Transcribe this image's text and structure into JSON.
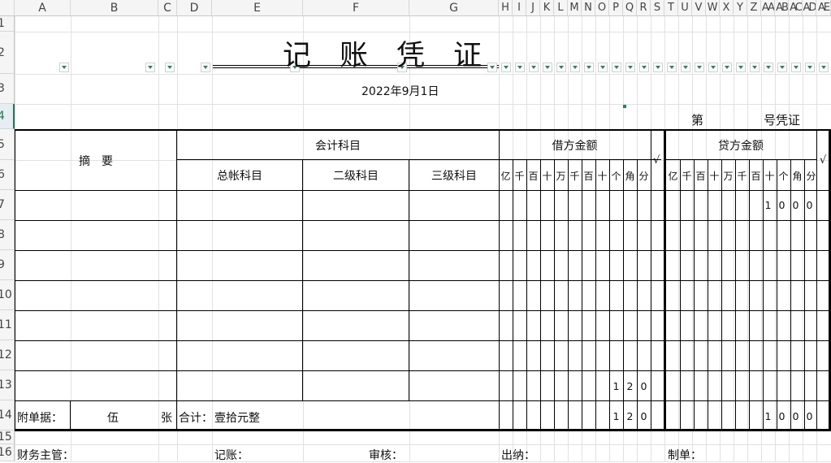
{
  "columns": [
    "A",
    "B",
    "C",
    "D",
    "E",
    "F",
    "G",
    "H",
    "I",
    "J",
    "K",
    "L",
    "M",
    "N",
    "O",
    "P",
    "Q",
    "R",
    "S",
    "T",
    "U",
    "V",
    "W",
    "X",
    "Y",
    "Z",
    "AA",
    "AB",
    "AC",
    "AD",
    "AE"
  ],
  "rows": [
    "1",
    "2",
    "3",
    "4",
    "5",
    "6",
    "7",
    "8",
    "9",
    "10",
    "11",
    "12",
    "13",
    "14",
    "15",
    "16"
  ],
  "title": "记　账　凭　证",
  "date": "2022年9月1日",
  "voucher_no_prefix": "第",
  "voucher_no_suffix": "号凭证",
  "headers": {
    "summary": "摘　要",
    "account_subject": "会计科目",
    "general_ledger": "总帐科目",
    "second_level": "二级科目",
    "third_level": "三级科目",
    "debit_amount": "借方金额",
    "credit_amount": "贷方金额",
    "check_mark": "√"
  },
  "digit_units": [
    "亿",
    "千",
    "百",
    "十",
    "万",
    "千",
    "百",
    "十",
    "个",
    "角",
    "分"
  ],
  "debit_rows": {
    "row13": [
      "",
      "",
      "",
      "",
      "",
      "",
      "",
      "1",
      "2",
      "0",
      ""
    ],
    "total": [
      "",
      "",
      "",
      "",
      "",
      "",
      "",
      "1",
      "2",
      "0",
      ""
    ]
  },
  "credit_rows": {
    "row7": [
      "",
      "",
      "",
      "",
      "",
      "",
      "1",
      "0",
      "0",
      "0",
      ""
    ],
    "total": [
      "",
      "",
      "",
      "",
      "",
      "",
      "1",
      "0",
      "0",
      "0",
      ""
    ]
  },
  "footer_row": {
    "attachments_label": "附单据：",
    "attachments_count": "伍",
    "attachments_unit": "张",
    "total_label": "合计：",
    "total_words": "壹拾元整"
  },
  "signatures": {
    "finance_supervisor": "财务主管：",
    "bookkeeper": "记账：",
    "reviewer": "审核：",
    "cashier": "出纳：",
    "preparer": "制单："
  },
  "colors": {
    "accent": "#1d7a4f",
    "grid": "#e1e1e1",
    "header_bg": "#f5f5f5"
  }
}
